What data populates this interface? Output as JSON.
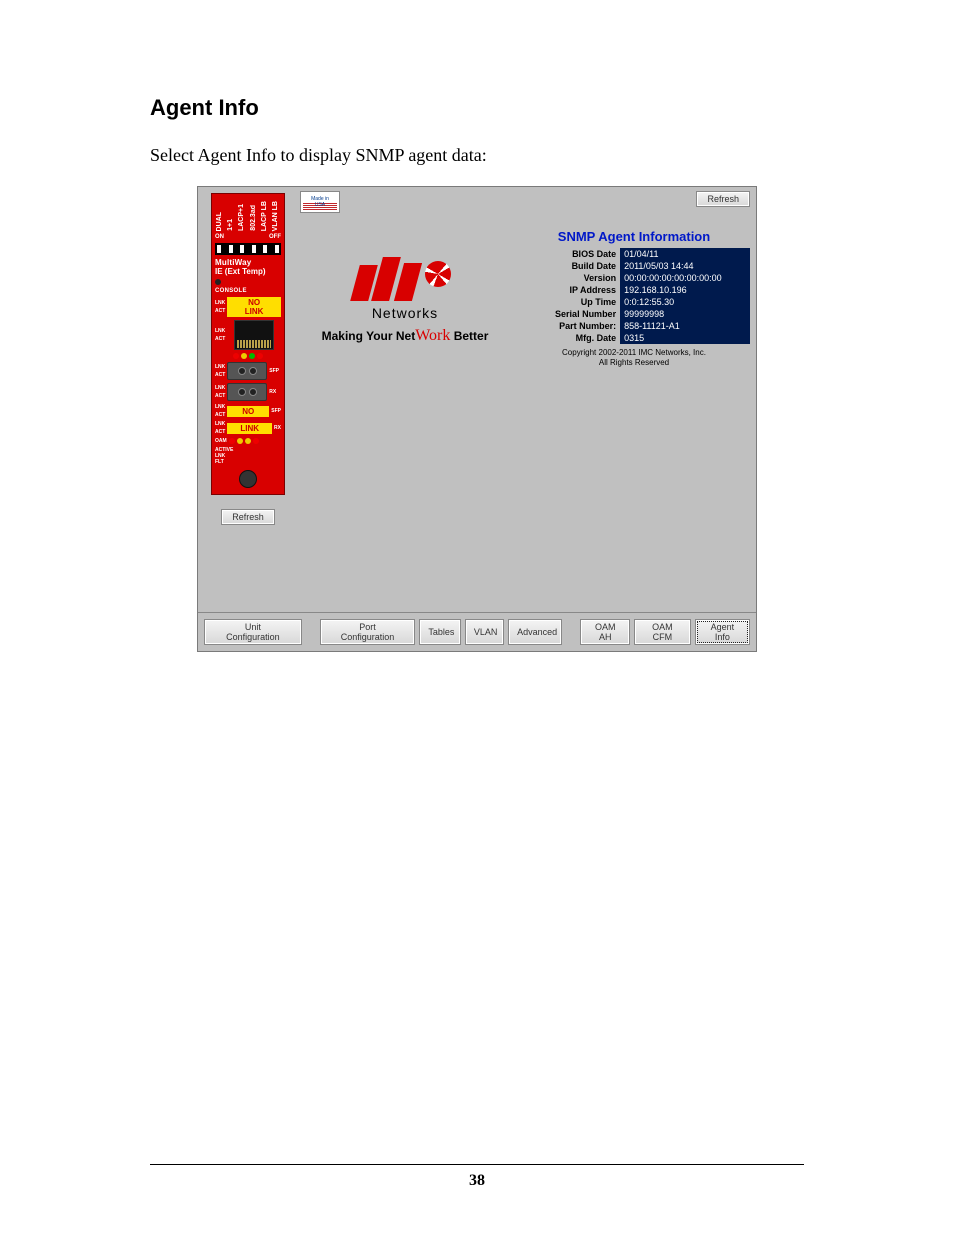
{
  "doc": {
    "section_title": "Agent Info",
    "section_desc": "Select Agent Info to display SNMP agent data:",
    "page_number": "38"
  },
  "sidebar": {
    "card": {
      "vlabels": [
        "DUAL",
        "1+1",
        "LACP+1",
        "802.3ad",
        "LACP LB",
        "VLAN LB"
      ],
      "dip_on": "ON",
      "dip_off": "OFF",
      "product1": "MultiWay",
      "product2": "IE (Ext Temp)",
      "console": "CONSOLE",
      "nolink": "NO\nLINK",
      "no": "NO",
      "link": "LINK",
      "oam": "OAM",
      "active": "ACTIVE",
      "lnk": "LNK",
      "flt": "FLT",
      "side_label_lnk": "LNK",
      "side_label_act": "ACT"
    },
    "refresh": "Refresh"
  },
  "main": {
    "usa_label": "Made in\nUSA",
    "refresh": "Refresh",
    "logo_sub": "Networks",
    "tagline_pre": "Making Your Net",
    "tagline_mid": "Work",
    "tagline_post": " Better"
  },
  "info": {
    "title": "SNMP Agent Information",
    "rows": [
      {
        "label": "BIOS Date",
        "value": "01/04/11"
      },
      {
        "label": "Build Date",
        "value": "2011/05/03 14:44"
      },
      {
        "label": "Version",
        "value": "00:00:00:00:00:00:00:00"
      },
      {
        "label": "IP Address",
        "value": "192.168.10.196"
      },
      {
        "label": "Up Time",
        "value": "0:0:12:55.30"
      },
      {
        "label": "Serial Number",
        "value": "99999998"
      },
      {
        "label": "Part Number:",
        "value": "858-11121-A1"
      },
      {
        "label": "Mfg. Date",
        "value": "0315"
      }
    ],
    "copyright1": "Copyright 2002-2011 IMC Networks, Inc.",
    "copyright2": "All Rights Reserved"
  },
  "tabs": {
    "unit": "Unit Configuration",
    "port": "Port Configuration",
    "tables": "Tables",
    "vlan": "VLAN",
    "adv": "Advanced",
    "oam_ah": "OAM AH",
    "oam_cfm": "OAM CFM",
    "agent": "Agent Info"
  }
}
